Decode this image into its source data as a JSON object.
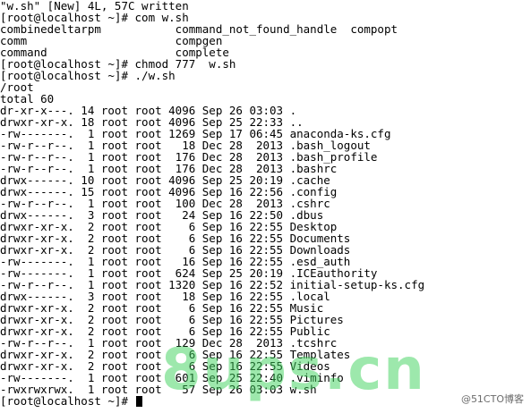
{
  "terminal": {
    "lines": [
      "\"w.sh\" [New] 4L, 57C written",
      "[root@localhost ~]# com w.sh",
      "combinedeltarpm           command_not_found_handle  compopt",
      "comm                      compgen",
      "command                   complete",
      "[root@localhost ~]# chmod 777  w.sh",
      "[root@localhost ~]# ./w.sh",
      "/root",
      "total 60",
      "dr-xr-x---. 14 root root 4096 Sep 26 03:03 .",
      "drwxr-xr-x. 18 root root 4096 Sep 25 22:33 ..",
      "-rw-------.  1 root root 1269 Sep 17 06:45 anaconda-ks.cfg",
      "-rw-r--r--.  1 root root   18 Dec 28  2013 .bash_logout",
      "-rw-r--r--.  1 root root  176 Dec 28  2013 .bash_profile",
      "-rw-r--r--.  1 root root  176 Dec 28  2013 .bashrc",
      "drwx------. 10 root root 4096 Sep 25 20:19 .cache",
      "drwx------. 15 root root 4096 Sep 16 22:56 .config",
      "-rw-r--r--.  1 root root  100 Dec 28  2013 .cshrc",
      "drwx------.  3 root root   24 Sep 16 22:50 .dbus",
      "drwxr-xr-x.  2 root root    6 Sep 16 22:55 Desktop",
      "drwxr-xr-x.  2 root root    6 Sep 16 22:55 Documents",
      "drwxr-xr-x.  2 root root    6 Sep 16 22:55 Downloads",
      "-rw-------.  1 root root   16 Sep 16 22:55 .esd_auth",
      "-rw-------.  1 root root  624 Sep 25 20:19 .ICEauthority",
      "-rw-r--r--.  1 root root 1320 Sep 16 22:52 initial-setup-ks.cfg",
      "drwx------.  3 root root   18 Sep 16 22:55 .local",
      "drwxr-xr-x.  2 root root    6 Sep 16 22:55 Music",
      "drwxr-xr-x.  2 root root    6 Sep 16 22:55 Pictures",
      "drwxr-xr-x.  2 root root    6 Sep 16 22:55 Public",
      "-rw-r--r--.  1 root root  129 Dec 28  2013 .tcshrc",
      "drwxr-xr-x.  2 root root    6 Sep 16 22:55 Templates",
      "drwxr-xr-x.  2 root root    6 Sep 16 22:55 Videos",
      "-rw-------.  1 root root  601 Sep 25 22:40 .viminfo",
      "-rwxrwxrwx.  1 root root   57 Sep 26 03:03 w.sh"
    ],
    "prompt": "[root@localhost ~]# "
  },
  "watermark": {
    "text": "8ups.cn",
    "brand": "@51CTO博客"
  },
  "colors": {
    "background": "#ffffff",
    "text": "#000000",
    "watermark_green": "#3cd25a",
    "brand_gray": "#6b6b6b"
  },
  "icons": {
    "cursor": "block-cursor"
  }
}
